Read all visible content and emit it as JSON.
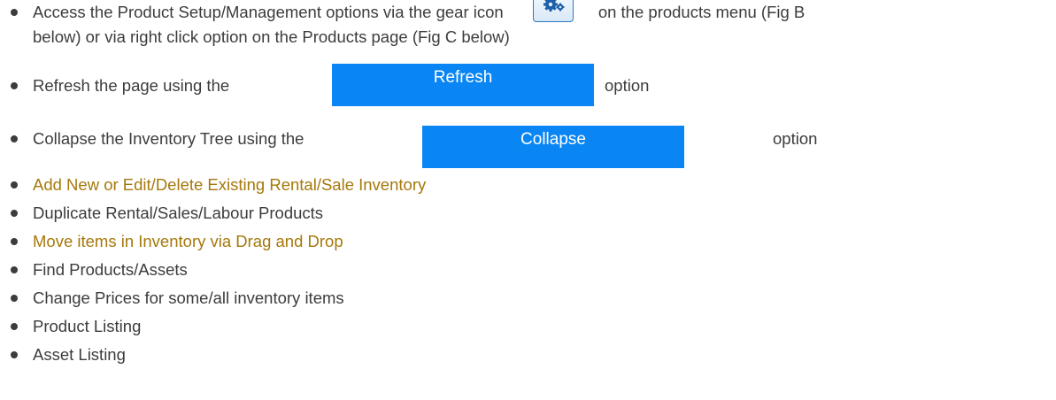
{
  "bullets": {
    "item1": {
      "before": "Access the Product Setup/Management options via the gear icon",
      "after": "on the products menu (Fig B",
      "line2": "below) or via right click option on the Products page (Fig C below)"
    },
    "item2": {
      "before": "Refresh the page using the",
      "button": "Refresh",
      "after": "option"
    },
    "item3": {
      "before": "Collapse the Inventory Tree  using the",
      "button": "Collapse",
      "after": "option"
    },
    "item4": "Add New or Edit/Delete Existing Rental/Sale Inventory",
    "item5": "Duplicate Rental/Sales/Labour Products",
    "item6": "Move items in Inventory via Drag and Drop",
    "item7": "Find Products/Assets",
    "item8": "Change Prices for some/all inventory items",
    "item9": "Product Listing",
    "item10": "Asset Listing"
  },
  "colors": {
    "text": "#3c3c3c",
    "link": "#a6780c",
    "button_blue": "#0a86f4"
  },
  "icons": {
    "gear": "gear-icon"
  }
}
